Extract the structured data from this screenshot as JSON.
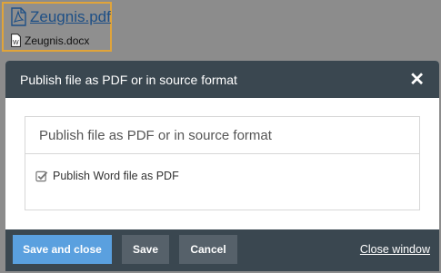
{
  "files": {
    "pdf": {
      "name": "Zeugnis.pdf",
      "icon": "pdf-file-icon"
    },
    "docx": {
      "name": "Zeugnis.docx",
      "icon": "word-file-icon"
    }
  },
  "dialog": {
    "title": "Publish file as PDF or in source format",
    "close_icon": "close-icon",
    "panel": {
      "heading": "Publish file as PDF or in source format",
      "option": {
        "label": "Publish Word file as PDF",
        "checked": true
      }
    },
    "footer": {
      "save_and_close": "Save and close",
      "save": "Save",
      "cancel": "Cancel",
      "close_window": "Close window"
    }
  },
  "colors": {
    "header_bg": "#3a4750",
    "primary_button": "#5aa0df",
    "secondary_button": "#56616a",
    "file_highlight": "#e0a43a",
    "link": "#1d4f86"
  }
}
